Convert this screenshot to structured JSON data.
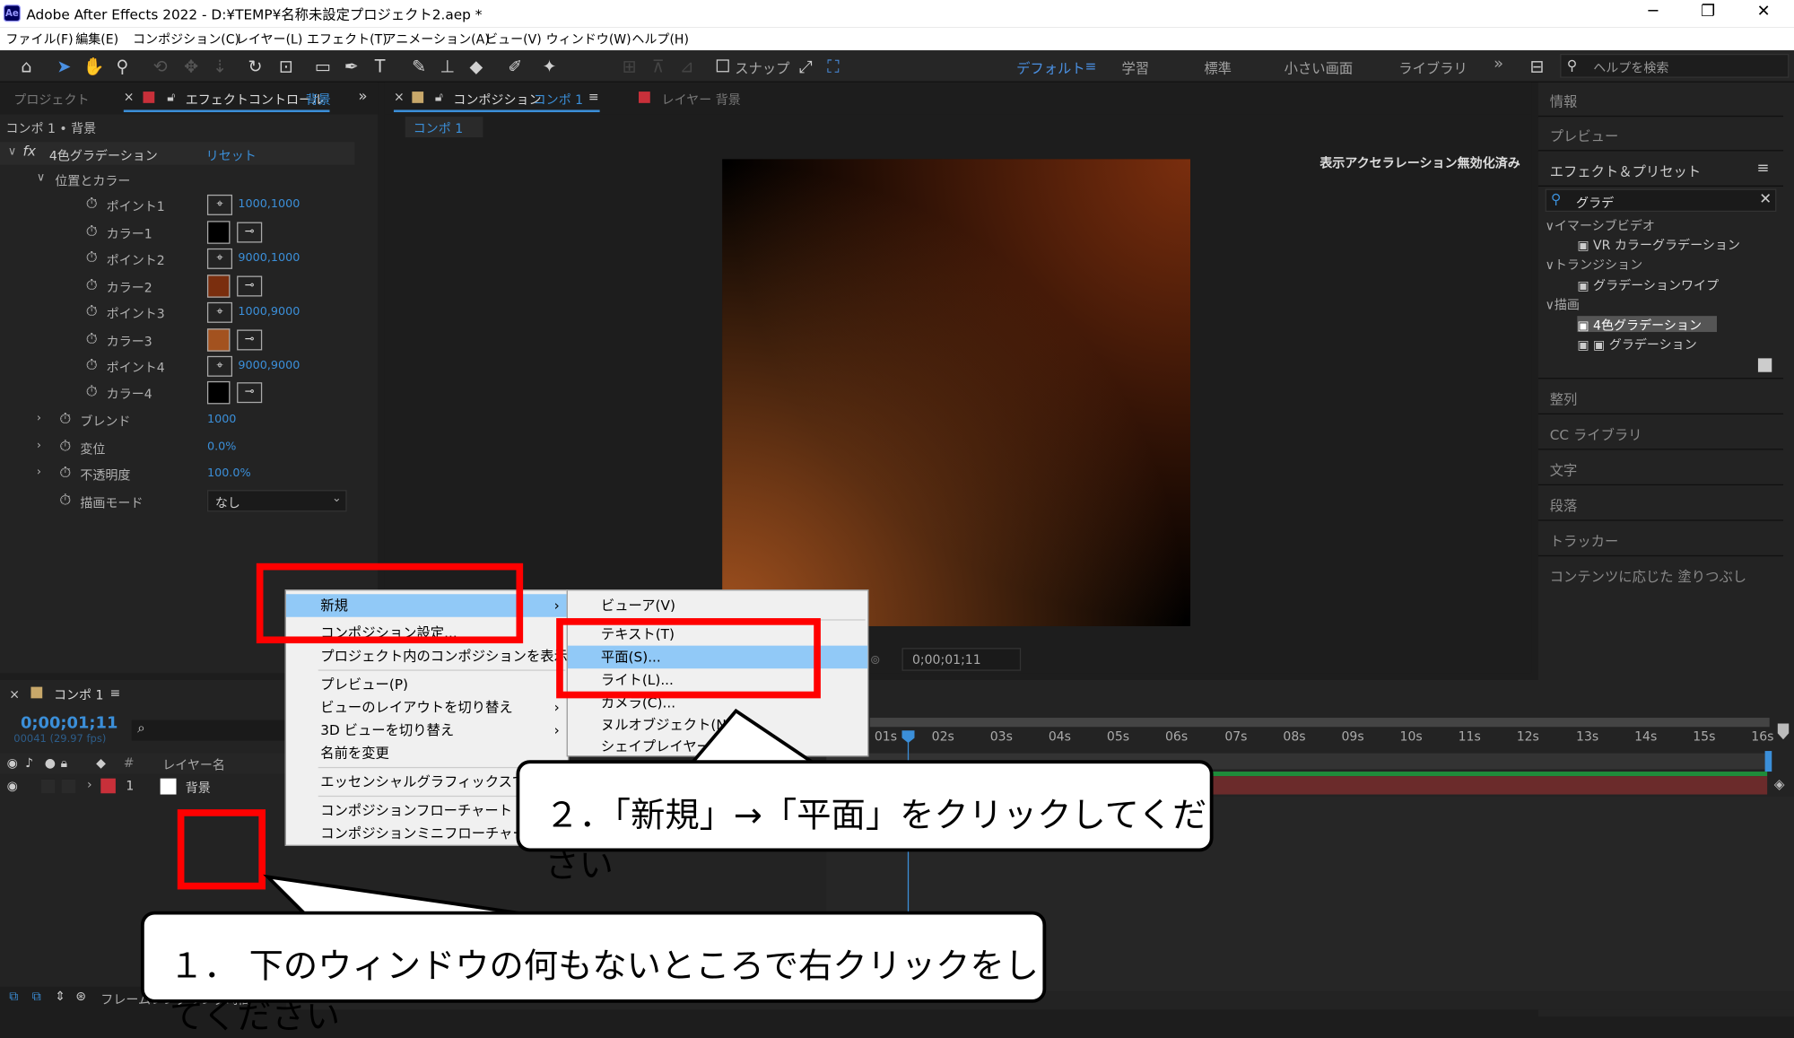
{
  "window": {
    "title": "Adobe After Effects 2022 - D:¥TEMP¥名称未設定プロジェクト2.aep *",
    "logo": "Ae",
    "minimize": "─",
    "maximize": "❐",
    "close": "✕"
  },
  "menu": [
    "ファイル(F)",
    "編集(E)",
    "コンポジション(C)",
    "レイヤー(L)",
    "エフェクト(T)",
    "アニメーション(A)",
    "ビュー(V)",
    "ウィンドウ(W)",
    "ヘルプ(H)"
  ],
  "toolbar": {
    "snap_label": "スナップ",
    "workspaces": [
      "デフォルト",
      "学習",
      "標準",
      "小さい画面",
      "ライブラリ"
    ],
    "workspace_menu": "≡",
    "overflow": "»",
    "help_placeholder": "ヘルプを検索"
  },
  "left_panel": {
    "tab_project": "プロジェクト",
    "tab_effect_controls": "エフェクトコントロール",
    "tab_effect_target": "背景",
    "overflow": "»",
    "breadcrumb": "コンポ 1 • 背景",
    "effect_name": "4色グラデーション",
    "reset": "リセット",
    "group_label": "位置とカラー",
    "rows": [
      {
        "label": "ポイント1",
        "value": "1000,1000"
      },
      {
        "label": "カラー1",
        "color": "#000000"
      },
      {
        "label": "ポイント2",
        "value": "9000,1000"
      },
      {
        "label": "カラー2",
        "color": "#7a2e0e"
      },
      {
        "label": "ポイント3",
        "value": "1000,9000"
      },
      {
        "label": "カラー3",
        "color": "#a3521f"
      },
      {
        "label": "ポイント4",
        "value": "9000,9000"
      },
      {
        "label": "カラー4",
        "color": "#000000"
      }
    ],
    "blend_label": "ブレンド",
    "blend_value": "1000",
    "jitter_label": "変位",
    "jitter_value": "0.0%",
    "opacity_label": "不透明度",
    "opacity_value": "100.0%",
    "mode_label": "描画モード",
    "mode_value": "なし"
  },
  "composition": {
    "tab_label": "コンポジション",
    "tab_name": "コンポ 1",
    "tab_menu": "≡",
    "layer_tab": "レイヤー 背景",
    "sub_tab": "コンポ 1",
    "accel_notice": "表示アクセラレーション無効化済み",
    "timecode": "0;00;01;11"
  },
  "context_menu": {
    "items": [
      "新規",
      "コンポジション設定...",
      "プロジェクト内のコンポジションを表示",
      "プレビュー(P)",
      "ビューのレイアウトを切り替え",
      "3D ビューを切り替え",
      "名前を変更",
      "エッセンシャルグラフィックスで開く",
      "コンポジションフローチャート",
      "コンポジションミニフローチャート"
    ],
    "arrow": "›"
  },
  "submenu": {
    "items": [
      "ビューア(V)",
      "テキスト(T)",
      "平面(S)...",
      "ライト(L)...",
      "カメラ(C)...",
      "ヌルオブジェクト(N)",
      "シェイプレイヤー"
    ]
  },
  "timeline": {
    "tab_name": "コンポ 1",
    "tab_menu": "≡",
    "timecode": "0;00;01;11",
    "frames": "00041 (29.97 fps)",
    "search_icon": "⌕",
    "col_num": "#",
    "col_layer_name": "レイヤー名",
    "layer_num": "1",
    "layer_name": "背景",
    "status": "フレームレンダリング時間",
    "ticks": [
      "01s",
      "02s",
      "03s",
      "04s",
      "05s",
      "06s",
      "07s",
      "08s",
      "09s",
      "10s",
      "11s",
      "12s",
      "13s",
      "14s",
      "15s",
      "16s"
    ]
  },
  "right_panel": {
    "info": "情報",
    "preview": "プレビュー",
    "effects_presets": "エフェクト＆プリセット",
    "menu": "≡",
    "search_value": "グラデ",
    "clear": "✕",
    "tree": [
      {
        "text": "イマーシブビデオ",
        "kind": "category"
      },
      {
        "text": "VR カラーグラデーション",
        "kind": "item"
      },
      {
        "text": "トランジション",
        "kind": "category"
      },
      {
        "text": "グラデーションワイプ",
        "kind": "item"
      },
      {
        "text": "描画",
        "kind": "category"
      },
      {
        "text": "4色グラデーション",
        "kind": "item-selected"
      },
      {
        "text": "グラデーション",
        "kind": "item"
      }
    ],
    "sections": [
      "整列",
      "CC ライブラリ",
      "文字",
      "段落",
      "トラッカー",
      "コンテンツに応じた 塗りつぶし"
    ]
  },
  "callouts": {
    "step2": "２．「新規」→「平面」をクリックしてください",
    "step1": "１． 下のウィンドウの何もないところで右クリックをしてください"
  },
  "colors": {
    "accent": "#3b8fd9",
    "highlight": "#91c9f7",
    "annotation": "#ff0000",
    "layer_bar": "#6b2b2b"
  }
}
